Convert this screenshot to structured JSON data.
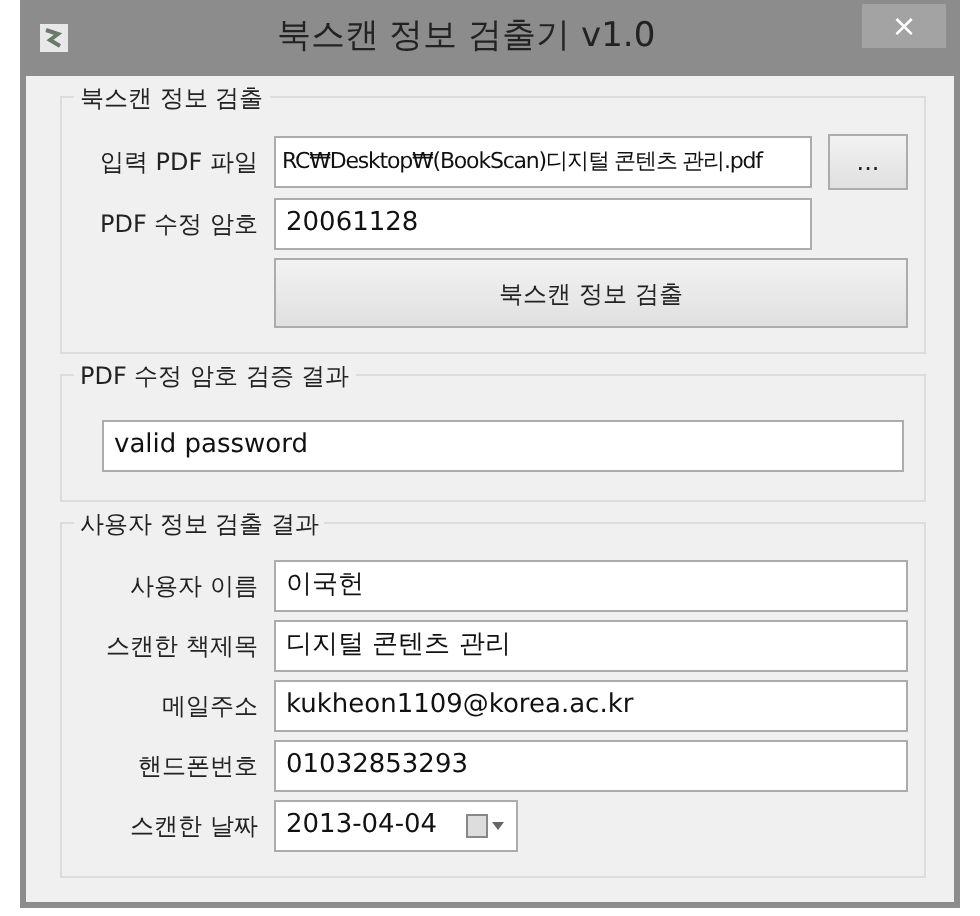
{
  "window": {
    "title": "북스캔 정보 검출기 v1.0",
    "close": "×"
  },
  "sections": [
    {
      "legend": "북스캔 정보 검출",
      "rows": [
        {
          "kind": "file",
          "label": "입력 PDF 파일",
          "value": "RC₩Desktop₩(BookScan)디지털 콘텐츠 관리.pdf",
          "button": "..."
        },
        {
          "kind": "field",
          "label": "PDF 수정 암호",
          "value": "20061128"
        },
        {
          "kind": "action",
          "button": "북스캔 정보 검출"
        }
      ]
    },
    {
      "legend": "PDF 수정 암호 검증 결과",
      "rows": [
        {
          "kind": "wide",
          "value": "valid password"
        }
      ]
    },
    {
      "legend": "사용자 정보 검출 결과",
      "rows": [
        {
          "kind": "field",
          "label": "사용자 이름",
          "value": "이국헌"
        },
        {
          "kind": "field",
          "label": "스캔한 책제목",
          "value": "디지털 콘텐츠 관리"
        },
        {
          "kind": "field",
          "label": "메일주소",
          "value": "kukheon1109@korea.ac.kr"
        },
        {
          "kind": "field",
          "label": "핸드폰번호",
          "value": "01032853293"
        },
        {
          "kind": "date",
          "label": "스캔한 날짜",
          "value": "2013-04-04"
        }
      ]
    }
  ]
}
